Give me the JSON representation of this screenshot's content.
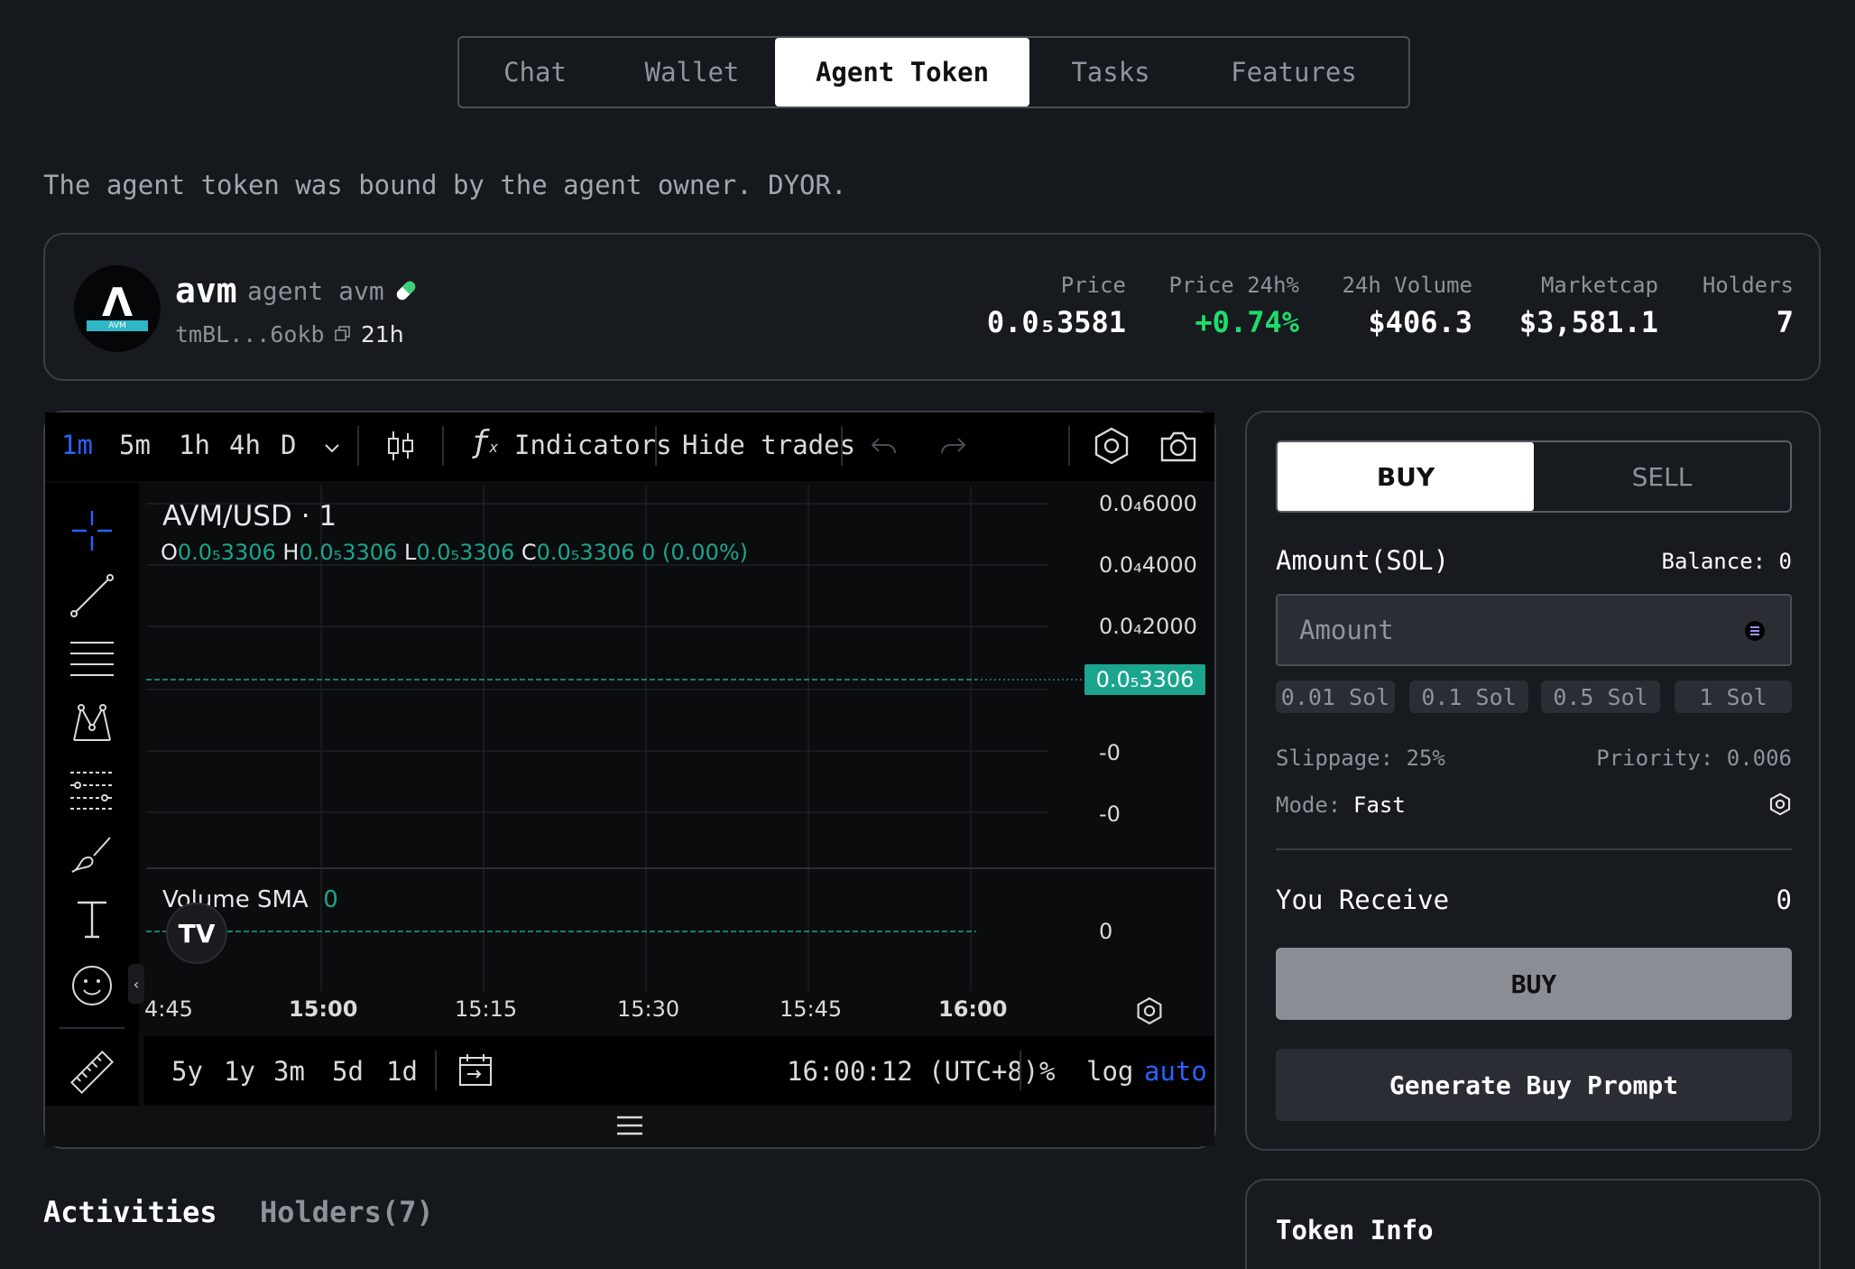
{
  "tabs": [
    "Chat",
    "Wallet",
    "Agent Token",
    "Tasks",
    "Features"
  ],
  "notice": "The agent token was bound by the agent owner. DYOR.",
  "token": {
    "avatar_text": "AVM",
    "symbol": "avm",
    "name": "agent avm",
    "address": "tmBL...6okb",
    "age": "21h",
    "stats": [
      {
        "label": "Price",
        "value": "0.0₅3581"
      },
      {
        "label": "Price 24h%",
        "value": "+0.74%"
      },
      {
        "label": "24h Volume",
        "value": "$406.3"
      },
      {
        "label": "Marketcap",
        "value": "$3,581.1"
      },
      {
        "label": "Holders",
        "value": "7"
      }
    ]
  },
  "chart": {
    "intervals": [
      "1m",
      "5m",
      "1h",
      "4h",
      "D"
    ],
    "indicators_label": "Indicators",
    "hide_trades_label": "Hide trades",
    "pair": "AVM/USD · 1",
    "ohlc": {
      "o_label": "O",
      "o": "0.0₅3306",
      "h_label": "H",
      "h": "0.0₅3306",
      "l_label": "L",
      "l": "0.0₅3306",
      "c_label": "C",
      "c": "0.0₅3306",
      "change": "0 (0.00%)"
    },
    "y_ticks": [
      "0.0₄6000",
      "0.0₄4000",
      "0.0₄2000",
      "-0",
      "-0"
    ],
    "last_price_tag": "0.0₅3306",
    "volume_label": "Volume SMA",
    "volume_value": "0",
    "volume_axis": "0",
    "x_ticks": [
      "4:45",
      "15:00",
      "15:15",
      "15:30",
      "15:45",
      "16:00"
    ],
    "ranges": [
      "5y",
      "1y",
      "3m",
      "5d",
      "1d"
    ],
    "clock": "16:00:12 (UTC+8)",
    "pct_label": "%",
    "log_label": "log",
    "auto_label": "auto"
  },
  "trade": {
    "buy_tab": "BUY",
    "sell_tab": "SELL",
    "amount_label": "Amount(SOL)",
    "balance_label": "Balance: 0",
    "amount_placeholder": "Amount",
    "quick": [
      "0.01 Sol",
      "0.1 Sol",
      "0.5 Sol",
      "1 Sol"
    ],
    "slippage": "Slippage: 25%",
    "priority": "Priority: 0.006",
    "mode_label": "Mode:",
    "mode_value": "Fast",
    "receive_label": "You Receive",
    "receive_value": "0",
    "buy_button": "BUY",
    "prompt_button": "Generate Buy Prompt"
  },
  "bottom_tabs": [
    "Activities",
    "Holders(7)"
  ],
  "token_info_title": "Token Info"
}
